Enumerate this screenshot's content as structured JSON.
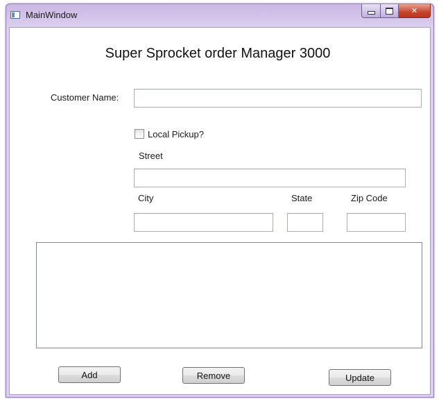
{
  "window": {
    "title": "MainWindow",
    "caption": {
      "minimize": "",
      "maximize": "",
      "close": "✕"
    }
  },
  "form": {
    "heading": "Super Sprocket order Manager 3000",
    "customer_name_label": "Customer Name:",
    "customer_name_value": "",
    "local_pickup_label": "Local Pickup?",
    "local_pickup_checked": false,
    "street_label": "Street",
    "street_value": "",
    "city_label": "City",
    "city_value": "",
    "state_label": "State",
    "state_value": "",
    "zip_label": "Zip Code",
    "zip_value": "",
    "orders_list": []
  },
  "buttons": {
    "add": "Add",
    "remove": "Remove",
    "update": "Update"
  },
  "colors": {
    "title_bar": "#cbb7e4",
    "close_button": "#c5462c"
  }
}
